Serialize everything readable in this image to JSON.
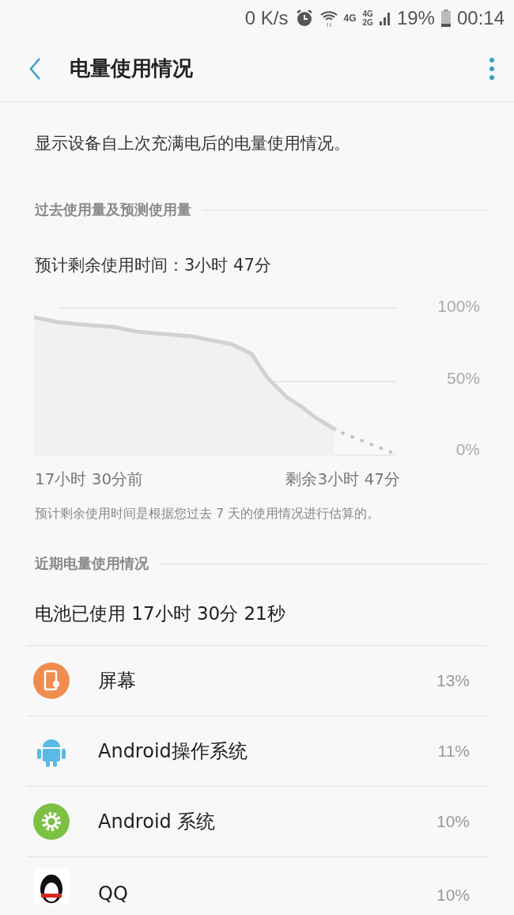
{
  "status_bar": {
    "speed": "0 K/s",
    "network": "4G",
    "sim_labels": [
      "4G",
      "2G"
    ],
    "battery": "19%",
    "time": "00:14"
  },
  "app_bar": {
    "title": "电量使用情况"
  },
  "description": "显示设备自上次充满电后的电量使用情况。",
  "history_section": {
    "header": "过去使用量及预测使用量",
    "estimate": "预计剩余使用时间：3小时 47分",
    "y_labels": [
      "100%",
      "50%",
      "0%"
    ],
    "x_labels": [
      "17小时 30分前",
      "剩余3小时 47分"
    ],
    "note": "预计剩余使用时间是根据您过去 7 天的使用情况进行估算的。"
  },
  "recent_section": {
    "header": "近期电量使用情况",
    "total": "电池已使用 17小时 30分 21秒",
    "apps": [
      {
        "kind": "screen",
        "name": "屏幕",
        "percent": "13%"
      },
      {
        "kind": "android",
        "name": "Android操作系统",
        "percent": "11%"
      },
      {
        "kind": "system",
        "name": "Android 系统",
        "percent": "10%"
      },
      {
        "kind": "penguin",
        "name": "QQ",
        "percent": "10%"
      }
    ]
  }
}
